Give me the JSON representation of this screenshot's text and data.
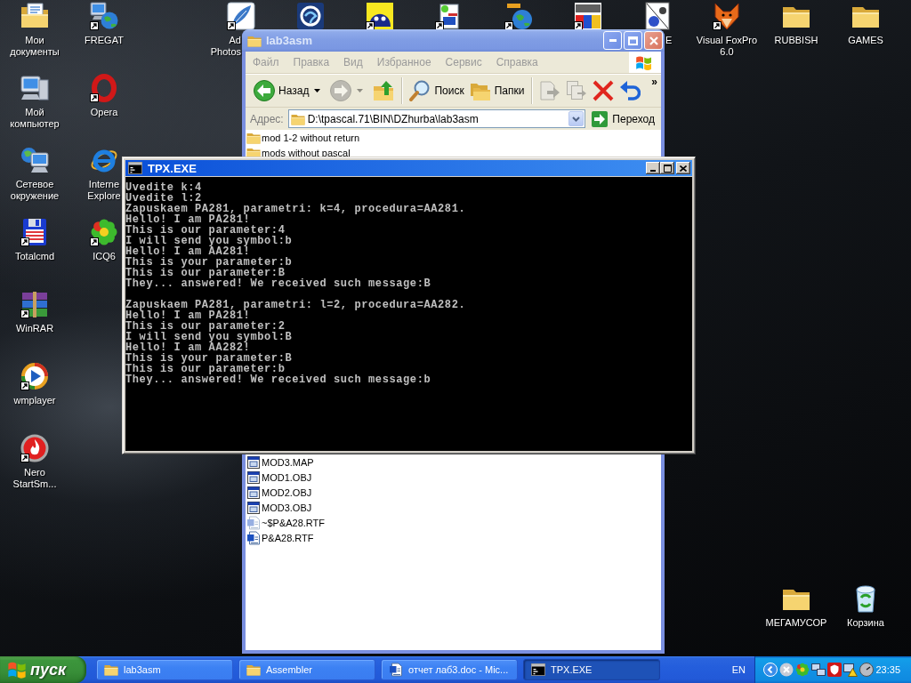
{
  "desktop": {
    "left_icons": [
      {
        "label": "Мои документы",
        "kind": "documents_folder",
        "shortcut": false
      },
      {
        "label": "Мой компьютер",
        "kind": "computer",
        "shortcut": false
      },
      {
        "label": "Сетевое окружение",
        "kind": "network",
        "shortcut": false
      },
      {
        "label": "Totalcmd",
        "kind": "floppy",
        "shortcut": true
      },
      {
        "label": "WinRAR",
        "kind": "archive",
        "shortcut": true
      },
      {
        "label": "wmplayer",
        "kind": "player",
        "shortcut": true
      },
      {
        "label": "Nero StartSm...",
        "kind": "flame",
        "shortcut": true
      },
      {
        "label": "FREGAT",
        "kind": "net_globe",
        "shortcut": true
      },
      {
        "label": "Opera",
        "kind": "ring_o",
        "shortcut": true
      },
      {
        "label": "Interne Explore",
        "kind": "ie",
        "shortcut": false
      },
      {
        "label": "ICQ6",
        "kind": "flower",
        "shortcut": true
      }
    ],
    "top_icons": [
      {
        "label": "Ad Photos",
        "kind": "feather",
        "shortcut": true
      },
      {
        "kind": "swirl",
        "shortcut": false
      },
      {
        "kind": "face",
        "shortcut": true
      },
      {
        "kind": "app32",
        "shortcut": true
      },
      {
        "kind": "globe",
        "shortcut": true
      },
      {
        "kind": "dos",
        "shortcut": true
      },
      {
        "label": "E",
        "kind": "tpx",
        "shortcut": false
      },
      {
        "label": "Visual FoxPro 6.0",
        "kind": "fox",
        "shortcut": true
      },
      {
        "label": "RUBBISH",
        "kind": "folder",
        "shortcut": false
      },
      {
        "label": "GAMES",
        "kind": "folder",
        "shortcut": false
      }
    ],
    "bottom_right_icons": [
      {
        "label": "МЕГАМУСОР",
        "kind": "folder",
        "shortcut": false
      },
      {
        "label": "Корзина",
        "kind": "recycle_bin",
        "shortcut": false
      }
    ]
  },
  "explorer_window": {
    "title": "lab3asm",
    "active": false,
    "menu": [
      "Файл",
      "Правка",
      "Вид",
      "Избранное",
      "Сервис",
      "Справка"
    ],
    "toolbar": [
      {
        "kind": "back",
        "label": "Назад",
        "disabled": false
      },
      {
        "kind": "forward",
        "disabled": true
      },
      {
        "kind": "up",
        "disabled": false
      },
      {
        "kind": "search",
        "label": "Поиск",
        "disabled": false
      },
      {
        "kind": "folders",
        "label": "Папки",
        "disabled": false
      },
      {
        "kind": "move",
        "disabled": true
      },
      {
        "kind": "copy",
        "disabled": true
      },
      {
        "kind": "delete",
        "disabled": false
      },
      {
        "kind": "undo",
        "disabled": false
      }
    ],
    "toolbar_overflow": "»",
    "address": {
      "label": "Адрес:",
      "value": "D:\\tpascal.71\\BIN\\DZhurba\\lab3asm",
      "go": "Переход"
    },
    "file_list": {
      "groups": [
        {
          "items": [
            {
              "name": "mod 1-2 without return",
              "kind": "folder",
              "hidden": false
            },
            {
              "name": "mods without pascal",
              "kind": "folder",
              "hidden": false
            }
          ]
        },
        {
          "items": [
            {
              "name": "MOD3.MAP",
              "kind": "app_file",
              "hidden": false
            },
            {
              "name": "MOD1.OBJ",
              "kind": "app_file",
              "hidden": false
            },
            {
              "name": "MOD2.OBJ",
              "kind": "app_file",
              "hidden": false
            },
            {
              "name": "MOD3.OBJ",
              "kind": "app_file",
              "hidden": false
            },
            {
              "name": "~$P&A28.RTF",
              "kind": "document",
              "hidden": true
            },
            {
              "name": "P&A28.RTF",
              "kind": "document",
              "hidden": false
            }
          ]
        }
      ]
    }
  },
  "console_window": {
    "title": "TPX.EXE",
    "active": true,
    "output_blocks": [
      [
        "Uvedite k:4",
        "Uvedite l:2",
        "Zapuskaem PA281, parametri: k=4, procedura=AA281.",
        "Hello! I am PA281!",
        "This is our parameter:4",
        "I will send you symbol:b",
        "Hello! I am AA281!",
        "This is your parameter:b",
        "This is our parameter:B",
        "They... answered! We received such message:B"
      ],
      [
        "Zapuskaem PA281, parametri: l=2, procedura=AA282.",
        "Hello! I am PA281!",
        "This is our parameter:2",
        "I will send you symbol:B",
        "Hello! I am AA282!",
        "This is your parameter:B",
        "This is our parameter:b",
        "They... answered! We received such message:b"
      ]
    ]
  },
  "taskbar": {
    "start": "пуск",
    "tasks": [
      {
        "label": "lab3asm",
        "kind": "folder",
        "selected": false
      },
      {
        "label": "Assembler",
        "kind": "folder",
        "selected": false
      },
      {
        "label": "отчет лаб3.doc - Mic...",
        "kind": "document",
        "selected": false
      },
      {
        "label": "TPX.EXE",
        "kind": "console",
        "selected": true
      }
    ],
    "language": "EN",
    "clock": "23:35"
  }
}
